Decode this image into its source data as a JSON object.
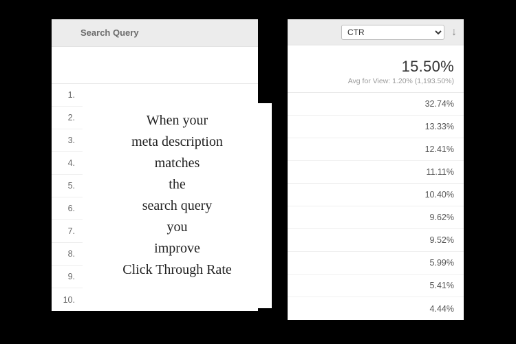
{
  "left": {
    "header": "Search Query",
    "rows": [
      "1.",
      "2.",
      "3.",
      "4.",
      "5.",
      "6.",
      "7.",
      "8.",
      "9.",
      "10."
    ]
  },
  "overlay": {
    "lines": [
      "When your",
      "meta description",
      "matches",
      "the",
      "search query",
      "you",
      "improve",
      "Click Through Rate"
    ]
  },
  "right": {
    "selectValue": "CTR",
    "sortIcon": "↓",
    "summaryValue": "15.50%",
    "summarySub": "Avg for View: 1.20% (1,193.50%)",
    "values": [
      "32.74%",
      "13.33%",
      "12.41%",
      "11.11%",
      "10.40%",
      "9.62%",
      "9.52%",
      "5.99%",
      "5.41%",
      "4.44%"
    ]
  }
}
